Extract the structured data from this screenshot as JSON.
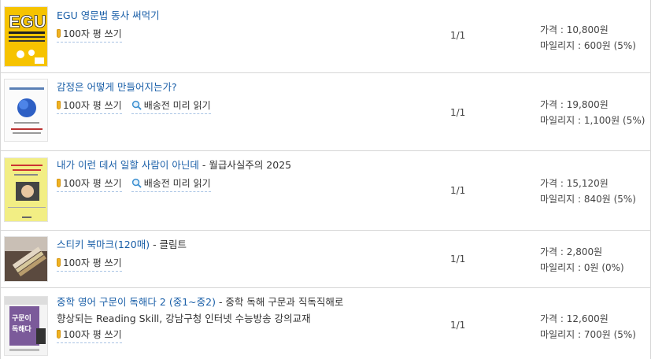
{
  "items": [
    {
      "title": "EGU 영문법 동사 써먹기",
      "subtitle": "",
      "extra": "",
      "actions": [
        "100자 평 쓰기"
      ],
      "qty": "1/1",
      "price": "가격 : 10,800원",
      "mileage": "마일리지 : 600원 (5%)",
      "cover_text": "EGU"
    },
    {
      "title": "감정은 어떻게 만들어지는가?",
      "subtitle": "",
      "extra": "",
      "actions": [
        "100자 평 쓰기",
        "배송전 미리 읽기"
      ],
      "qty": "1/1",
      "price": "가격 : 19,800원",
      "mileage": "마일리지 : 1,100원 (5%)",
      "cover_text": "감정은 어떻게 만들어지는가?"
    },
    {
      "title": "내가 이런 데서 일할 사람이 아닌데",
      "subtitle": " - 월급사실주의 2025",
      "extra": "",
      "actions": [
        "100자 평 쓰기",
        "배송전 미리 읽기"
      ],
      "qty": "1/1",
      "price": "가격 : 15,120원",
      "mileage": "마일리지 : 840원 (5%)",
      "cover_text": ""
    },
    {
      "title": "스티키 북마크(120매)",
      "subtitle": " - 클림트",
      "extra": "",
      "actions": [
        "100자 평 쓰기"
      ],
      "qty": "1/1",
      "price": "가격 : 2,800원",
      "mileage": "마일리지 : 0원 (0%)",
      "cover_text": ""
    },
    {
      "title": "중학 영어 구문이 독해다 2 (중1~중2)",
      "subtitle": " - 중학 독해 구문과 직독직해로",
      "extra": "향상되는 Reading Skill, 강남구청 인터넷 수능방송 강의교재",
      "actions": [
        "100자 평 쓰기"
      ],
      "qty": "1/1",
      "price": "가격 : 12,600원",
      "mileage": "마일리지 : 700원 (5%)",
      "cover_text": "구문이 독해다"
    }
  ],
  "colors": {
    "link": "#1a5fa8",
    "border": "#d6d6d6"
  }
}
